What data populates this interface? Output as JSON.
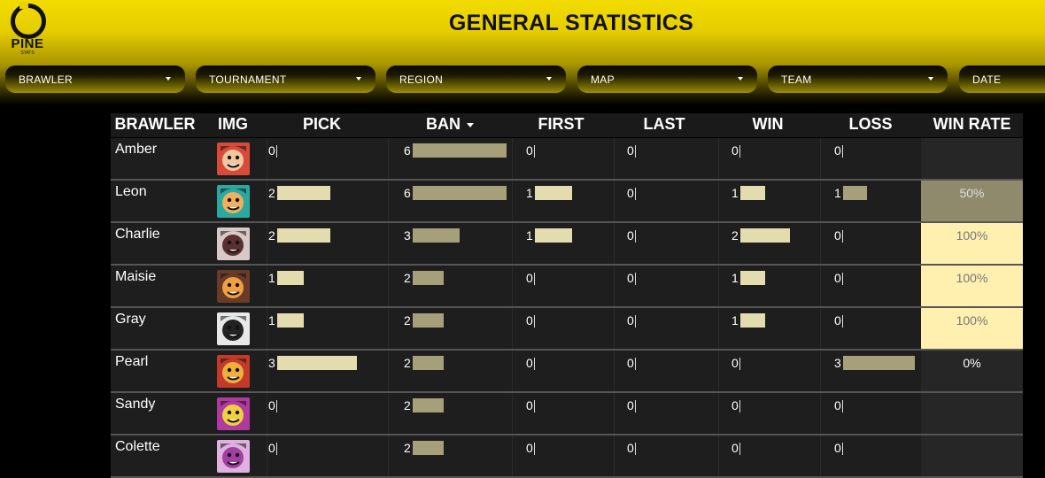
{
  "app": {
    "logo_text": "PINE",
    "logo_sub": "STATS",
    "title": "GENERAL STATISTICS"
  },
  "filters": [
    {
      "label": "BRAWLER"
    },
    {
      "label": "TOURNAMENT"
    },
    {
      "label": "REGION"
    },
    {
      "label": "MAP"
    },
    {
      "label": "TEAM"
    },
    {
      "label": "DATE"
    }
  ],
  "table": {
    "columns": [
      "BRAWLER",
      "IMG",
      "PICK",
      "BAN",
      "FIRST",
      "LAST",
      "WIN",
      "LOSS",
      "WIN RATE"
    ],
    "sorted_column": "BAN",
    "rows": [
      {
        "name": "Amber",
        "pick": "0",
        "ban": "6",
        "first": "0",
        "last": "0",
        "win": "0",
        "loss": "0",
        "win_rate": ""
      },
      {
        "name": "Leon",
        "pick": "2",
        "ban": "6",
        "first": "1",
        "last": "0",
        "win": "1",
        "loss": "1",
        "win_rate": "50%"
      },
      {
        "name": "Charlie",
        "pick": "2",
        "ban": "3",
        "first": "1",
        "last": "0",
        "win": "2",
        "loss": "0",
        "win_rate": "100%"
      },
      {
        "name": "Maisie",
        "pick": "1",
        "ban": "2",
        "first": "0",
        "last": "0",
        "win": "1",
        "loss": "0",
        "win_rate": "100%"
      },
      {
        "name": "Gray",
        "pick": "1",
        "ban": "2",
        "first": "0",
        "last": "0",
        "win": "1",
        "loss": "0",
        "win_rate": "100%"
      },
      {
        "name": "Pearl",
        "pick": "3",
        "ban": "2",
        "first": "0",
        "last": "0",
        "win": "0",
        "loss": "3",
        "win_rate": "0%"
      },
      {
        "name": "Sandy",
        "pick": "0",
        "ban": "2",
        "first": "0",
        "last": "0",
        "win": "0",
        "loss": "0",
        "win_rate": ""
      },
      {
        "name": "Colette",
        "pick": "0",
        "ban": "2",
        "first": "0",
        "last": "0",
        "win": "0",
        "loss": "0",
        "win_rate": ""
      }
    ]
  },
  "colors": {
    "bar_light": "#e3dcae",
    "bar_dark": "#a6a07a",
    "winrate_high": "#fff0b0",
    "winrate_mid": "#8f8a6c",
    "winrate_none": "#262626"
  },
  "avatars": [
    {
      "icon": "amber-portrait-icon",
      "bg": "#d84a3a",
      "fg": "#f2c8a0"
    },
    {
      "icon": "leon-portrait-icon",
      "bg": "#2aa9a0",
      "fg": "#f0b060"
    },
    {
      "icon": "charlie-portrait-icon",
      "bg": "#d9c8c8",
      "fg": "#5a3030"
    },
    {
      "icon": "maisie-portrait-icon",
      "bg": "#6b3b2a",
      "fg": "#f0a040"
    },
    {
      "icon": "gray-portrait-icon",
      "bg": "#e8e8e8",
      "fg": "#222222"
    },
    {
      "icon": "pearl-portrait-icon",
      "bg": "#c43a2a",
      "fg": "#f0b040"
    },
    {
      "icon": "sandy-portrait-icon",
      "bg": "#b03aa0",
      "fg": "#f0d040"
    },
    {
      "icon": "colette-portrait-icon",
      "bg": "#e0b0e0",
      "fg": "#a040a0"
    }
  ]
}
